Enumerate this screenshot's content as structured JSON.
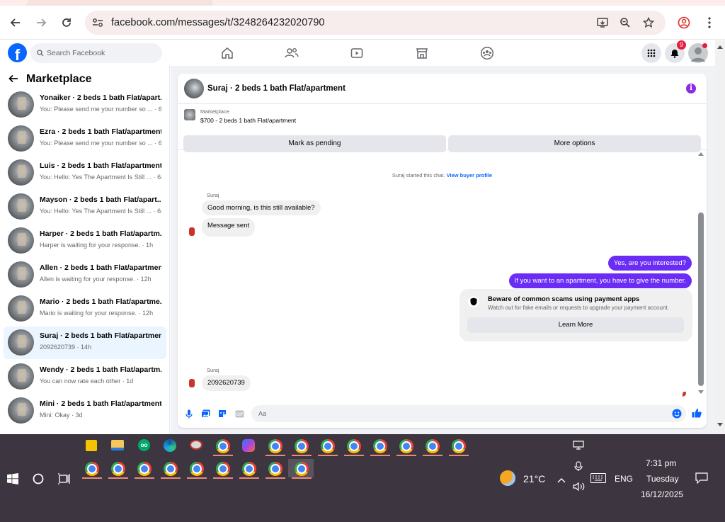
{
  "browser": {
    "url": "facebook.com/messages/t/3248264232020790"
  },
  "fb": {
    "logo_letter": "f",
    "search_placeholder": "Search Facebook",
    "notifications_count": "9"
  },
  "sidebar": {
    "title": "Marketplace",
    "conversations": [
      {
        "name": "Yonaiker · 2 beds 1 bath Flat/apart...",
        "preview": "You: Please send me your number so ... · 6m"
      },
      {
        "name": "Ezra · 2 beds 1 bath Flat/apartment",
        "preview": "You: Please send me your number so ... · 6m"
      },
      {
        "name": "Luis · 2 beds 1 bath Flat/apartment",
        "preview": "You: Hello: Yes The Apartment Is Still ... · 6m"
      },
      {
        "name": "Mayson · 2 beds 1 bath Flat/apart...",
        "preview": "You: Hello: Yes The Apartment Is Still ... · 6m"
      },
      {
        "name": "Harper · 2 beds 1 bath Flat/apartm...",
        "preview": "Harper is waiting for your response. · 1h"
      },
      {
        "name": "Allen · 2 beds 1 bath Flat/apartment",
        "preview": "Allen is waiting for your response. · 12h"
      },
      {
        "name": "Mario · 2 beds 1 bath Flat/apartme...",
        "preview": "Mario is waiting for your response. · 12h"
      },
      {
        "name": "Suraj · 2 beds 1 bath Flat/apartment",
        "preview": "2092620739 · 14h"
      },
      {
        "name": "Wendy · 2 beds 1 bath Flat/apartm...",
        "preview": "You can now rate each other · 1d"
      },
      {
        "name": "Mini · 2 beds 1 bath Flat/apartment",
        "preview": "Mini: Okay · 3d"
      }
    ]
  },
  "chat": {
    "title": "Suraj · 2 beds 1 bath Flat/apartment",
    "listing_label": "Marketplace",
    "listing_price": "$700 - 2 beds 1 bath Flat/apartment",
    "btn_pending": "Mark as pending",
    "btn_more": "More options",
    "system_text": "Suraj started this chat.",
    "system_link": "View buyer profile",
    "sender_name": "Suraj",
    "msg_in_1": "Good morning, is this still available?",
    "msg_in_2": "Message sent",
    "msg_out_1": "Yes, are you interested?",
    "msg_out_2": "If you want to  an apartment, you have to give the number.",
    "scam_title": "Beware of common scams using payment apps",
    "scam_sub": "Watch out for fake emails or requests to upgrade your payment account.",
    "scam_btn": "Learn More",
    "msg_in_3": "2092620739",
    "composer_placeholder": "Aa"
  },
  "taskbar": {
    "temperature": "21°C",
    "language": "ENG",
    "time": "7:31 pm",
    "day": "Tuesday",
    "date": "16/12/2025"
  },
  "colors": {
    "fb_blue": "#0866ff",
    "outgoing_bubble": "#6b2cf5",
    "taskbar": "#3d3640"
  }
}
